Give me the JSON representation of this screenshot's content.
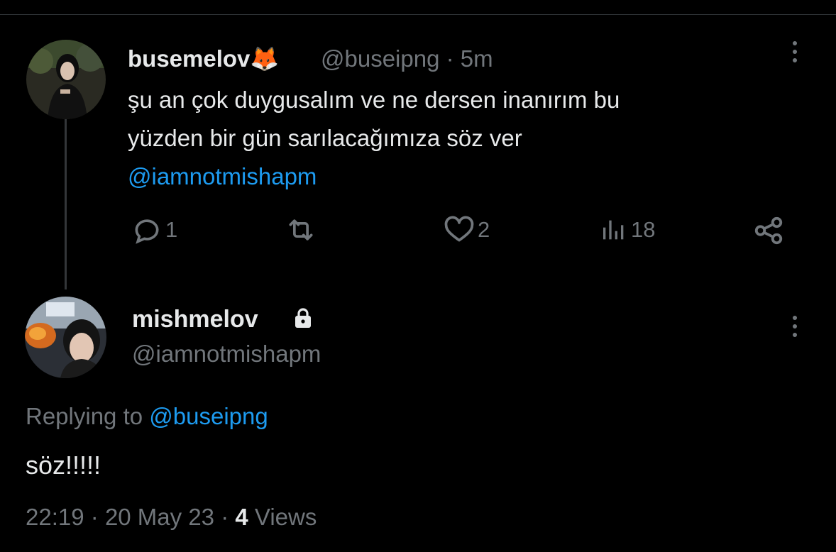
{
  "parent_tweet": {
    "display_name": "busemelov",
    "name_emoji": "🦊",
    "handle": "@buseipng",
    "separator": "·",
    "time_ago": "5m",
    "text_line1": "şu an çok duygusalım ve ne dersen inanırım bu",
    "text_line2": "yüzden bir gün sarılacağımıza söz ver",
    "mention": "@iamnotmishapm",
    "actions": {
      "replies": "1",
      "reposts": "",
      "likes": "2",
      "views": "18"
    }
  },
  "reply_tweet": {
    "display_name": "mishmelov",
    "protected_icon": "lock-icon",
    "handle": "@iamnotmishapm",
    "replying_prefix": "Replying to",
    "replying_to": "@buseipng",
    "text": "söz!!!!!",
    "time": "22:19",
    "date": "20 May 23",
    "separator": "·",
    "views_count": "4",
    "views_label": "Views"
  },
  "colors": {
    "background": "#000000",
    "text": "#e7e9ea",
    "muted": "#71767b",
    "accent": "#1d9bf0"
  }
}
